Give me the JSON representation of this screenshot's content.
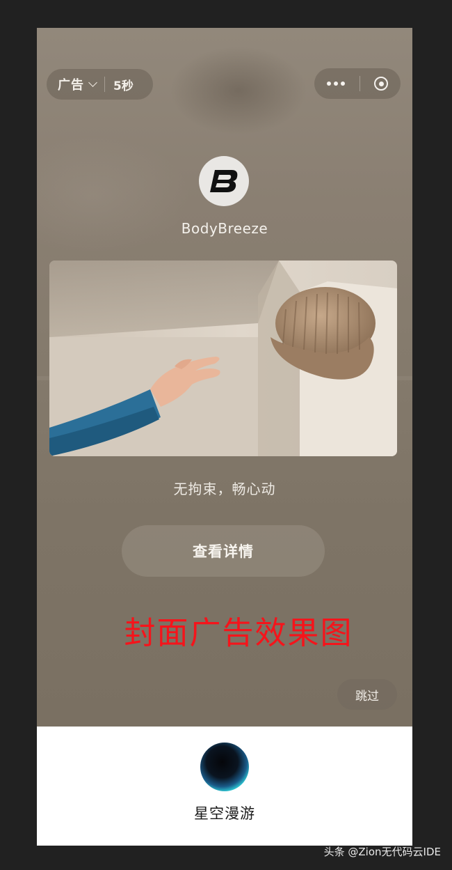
{
  "ad_badge": {
    "label": "广告",
    "countdown": "5秒"
  },
  "capsule_menu": {
    "more_icon": "more-dots-icon",
    "close_icon": "target-close-icon"
  },
  "brand": {
    "name": "BodyBreeze",
    "logo_letter": "B"
  },
  "hero_image": {
    "description_icon": "hand-reaching-beanie-image"
  },
  "tagline": "无拘束，畅心动",
  "details_button": "查看详情",
  "overlay_caption": "封面广告效果图",
  "skip_button": "跳过",
  "app": {
    "name": "星空漫游"
  },
  "watermark": "头条 @Zion无代码云IDE",
  "colors": {
    "ad_bg": "#857b6d",
    "caption_red": "#f5141b",
    "page_bg": "#212121"
  }
}
